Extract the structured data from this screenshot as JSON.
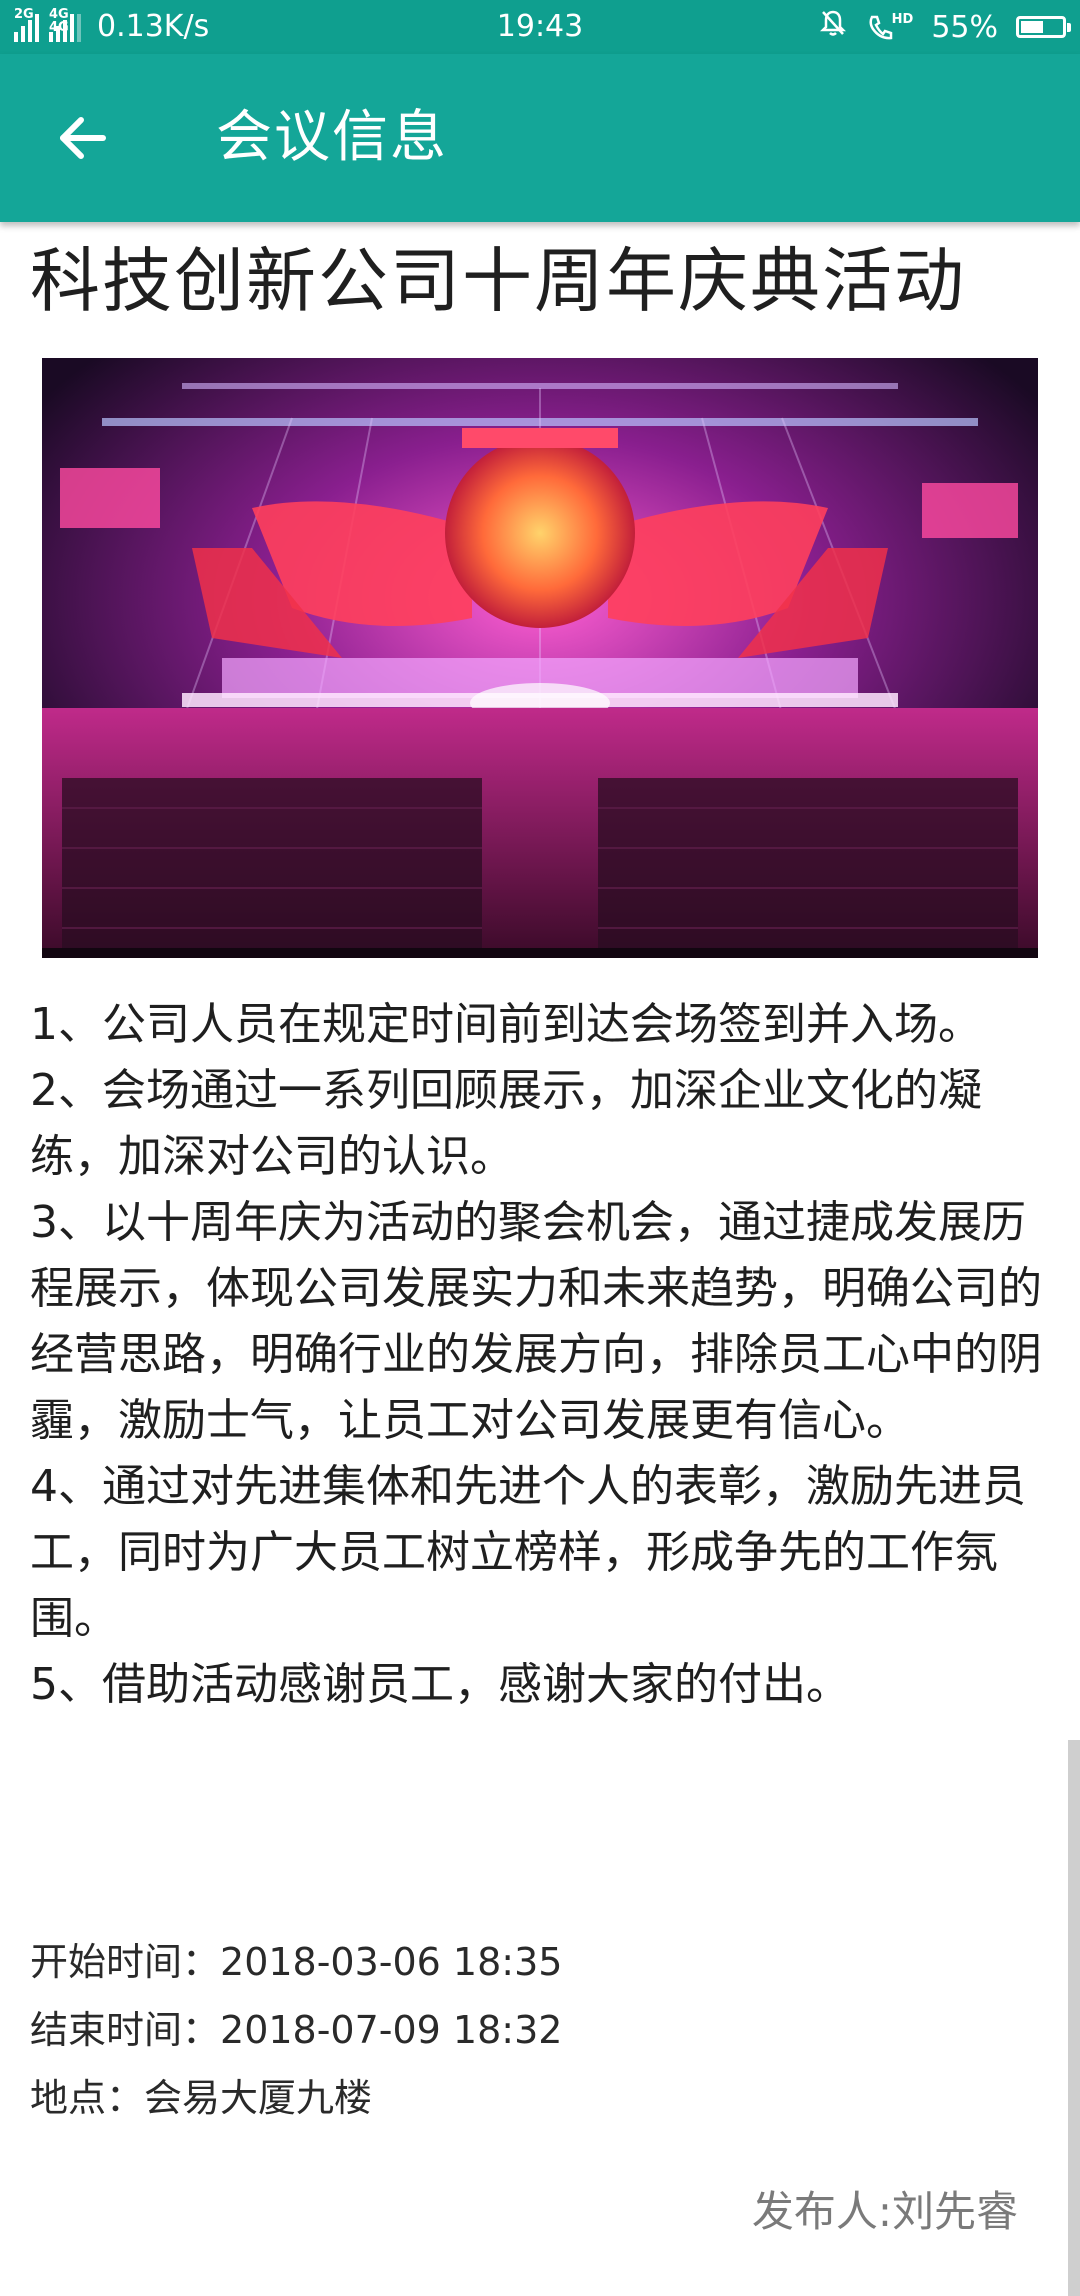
{
  "status_bar": {
    "network_1": "2G",
    "network_2": "4G 4G",
    "speed": "0.13K/s",
    "time": "19:43",
    "battery_text": "55%",
    "battery_level": 0.55,
    "hd_label": "HD"
  },
  "app_bar": {
    "title": "会议信息",
    "back_icon": "arrow-left-icon"
  },
  "event": {
    "title": "科技创新公司十周年庆典活动",
    "image_caption": "",
    "items": [
      "1、公司人员在规定时间前到达会场签到并入场。",
      "2、会场通过一系列回顾展示，加深企业文化的凝练，加深对公司的认识。",
      "3、以十周年庆为活动的聚会机会，通过捷成发展历程展示，体现公司发展实力和未来趋势，明确公司的经营思路，明确行业的发展方向，排除员工心中的阴霾，激励士气，让员工对公司发展更有信心。",
      "4、通过对先进集体和先进个人的表彰，激励先进员工，同时为广大员工树立榜样，形成争先的工作氛围。",
      "5、借助活动感谢员工，感谢大家的付出。"
    ],
    "start_label": "开始时间：",
    "start_value": "2018-03-06 18:35",
    "end_label": "结束时间：",
    "end_value": "2018-07-09 18:32",
    "location_label": "地点：",
    "location_value": "会易大厦九楼",
    "publisher": "发布人:刘先睿"
  },
  "colors": {
    "status_bar": "#0f9f8f",
    "app_bar": "#14a698",
    "text": "#1f1f1f",
    "muted": "#7a7a7a"
  }
}
